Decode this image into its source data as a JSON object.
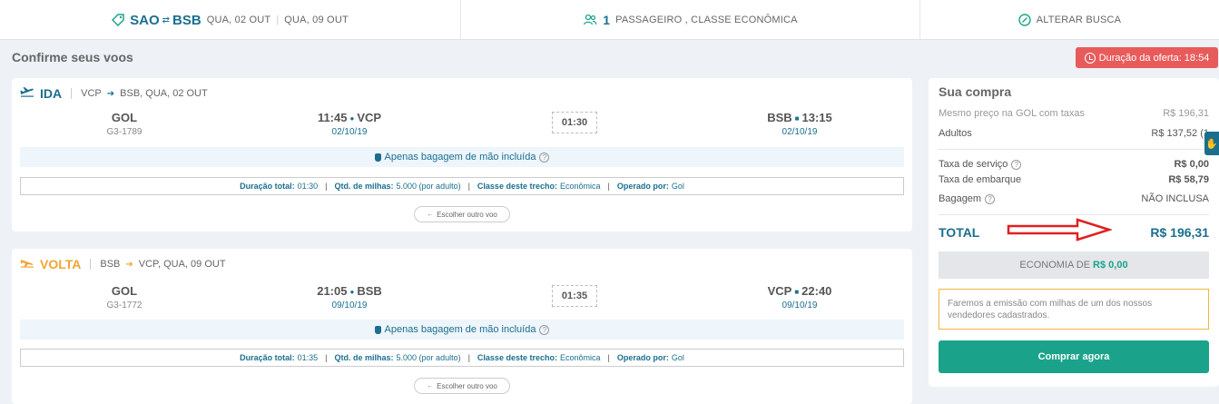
{
  "search_bar": {
    "origin": "SAO",
    "destination": "BSB",
    "depart_date": "QUA, 02 OUT",
    "return_date": "QUA, 09 OUT",
    "passenger_count": "1",
    "passenger_text": "PASSAGEIRO , CLASSE ECONÔMICA",
    "change_search": "ALTERAR BUSCA"
  },
  "page_title": "Confirme seus voos",
  "offer_timer": "Duração da oferta: 18:54",
  "flights": [
    {
      "direction": "IDA",
      "route_from": "VCP",
      "route_to": "BSB, QUA, 02 OUT",
      "airline": "GOL",
      "flight_code": "G3-1789",
      "dep_time": "11:45",
      "dep_airport": "VCP",
      "dep_date": "02/10/19",
      "duration": "01:30",
      "arr_airport": "BSB",
      "arr_time": "13:15",
      "arr_date": "02/10/19",
      "baggage": "Apenas bagagem de mão incluída",
      "details": {
        "duration_label": "Duração total:",
        "duration_value": "01:30",
        "miles_label": "Qtd. de milhas:",
        "miles_value": "5.000 (por adulto)",
        "class_label": "Classe deste trecho:",
        "class_value": "Econômica",
        "operator_label": "Operado por:",
        "operator_value": "Gol"
      },
      "other_flight": "Escolher outro voo"
    },
    {
      "direction": "VOLTA",
      "route_from": "BSB",
      "route_to": "VCP, QUA, 09 OUT",
      "airline": "GOL",
      "flight_code": "G3-1772",
      "dep_time": "21:05",
      "dep_airport": "BSB",
      "dep_date": "09/10/19",
      "duration": "01:35",
      "arr_airport": "VCP",
      "arr_time": "22:40",
      "arr_date": "09/10/19",
      "baggage": "Apenas bagagem de mão incluída",
      "details": {
        "duration_label": "Duração total:",
        "duration_value": "01:35",
        "miles_label": "Qtd. de milhas:",
        "miles_value": "5.000 (por adulto)",
        "class_label": "Classe deste trecho:",
        "class_value": "Econômica",
        "operator_label": "Operado por:",
        "operator_value": "Gol"
      },
      "other_flight": "Escolher outro voo"
    }
  ],
  "summary": {
    "title": "Sua compra",
    "same_price_label": "Mesmo preço na GOL com taxas",
    "same_price_value": "R$ 196,31",
    "adults_label": "Adultos",
    "adults_value": "R$ 137,52 (1",
    "service_fee_label": "Taxa de serviço",
    "service_fee_value": "R$ 0,00",
    "boarding_fee_label": "Taxa de embarque",
    "boarding_fee_value": "R$ 58,79",
    "baggage_label": "Bagagem",
    "baggage_value": "NÃO INCLUSA",
    "total_label": "TOTAL",
    "total_value": "R$ 196,31",
    "savings_label": "ECONOMIA DE",
    "savings_value": "R$ 0,00",
    "notice": "Faremos a emissão com milhas de um dos nossos vendedores cadastrados.",
    "buy_button": "Comprar agora"
  },
  "colors": {
    "brand_blue": "#1a6f8f",
    "accent_green": "#1aa38a",
    "volta_orange": "#f2a531",
    "timer_red": "#e85b5b",
    "annotation_arrow": "#e02020"
  }
}
